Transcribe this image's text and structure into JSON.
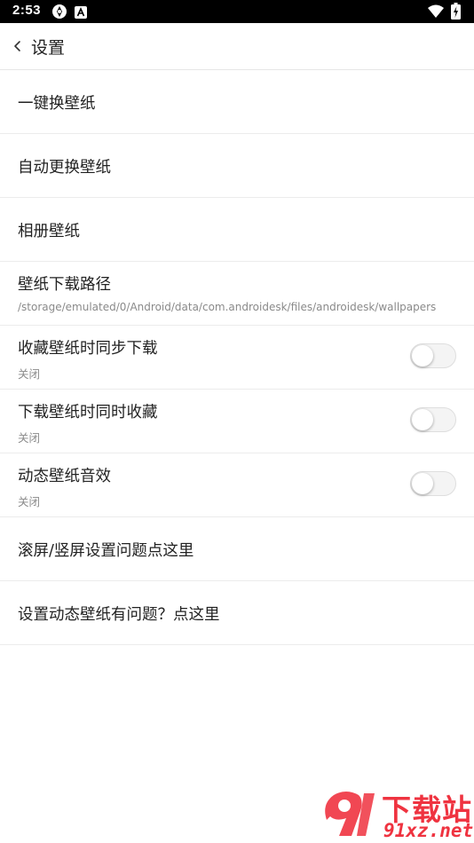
{
  "status_bar": {
    "time": "2:53",
    "icons": [
      "sync-icon",
      "a-badge-icon",
      "wifi-icon",
      "battery-charging-icon"
    ]
  },
  "header": {
    "back_icon": "chevron-left-icon",
    "title": "设置"
  },
  "settings": [
    {
      "label": "一键换壁纸"
    },
    {
      "label": "自动更换壁纸"
    },
    {
      "label": "相册壁纸"
    },
    {
      "label": "壁纸下载路径",
      "sub": "/storage/emulated/0/Android/data/com.androidesk/files/androidesk/wallpapers"
    },
    {
      "label": "收藏壁纸时同步下载",
      "sub": "关闭",
      "toggle": false
    },
    {
      "label": "下载壁纸时同时收藏",
      "sub": "关闭",
      "toggle": false
    },
    {
      "label": "动态壁纸音效",
      "sub": "关闭",
      "toggle": false
    },
    {
      "label": "滚屏/竖屏设置问题点这里"
    },
    {
      "label": "设置动态壁纸有问题？点这里"
    }
  ],
  "watermark": {
    "text_top": "下载站",
    "text_bottom": "91xz.net",
    "color": "#ef3340"
  }
}
